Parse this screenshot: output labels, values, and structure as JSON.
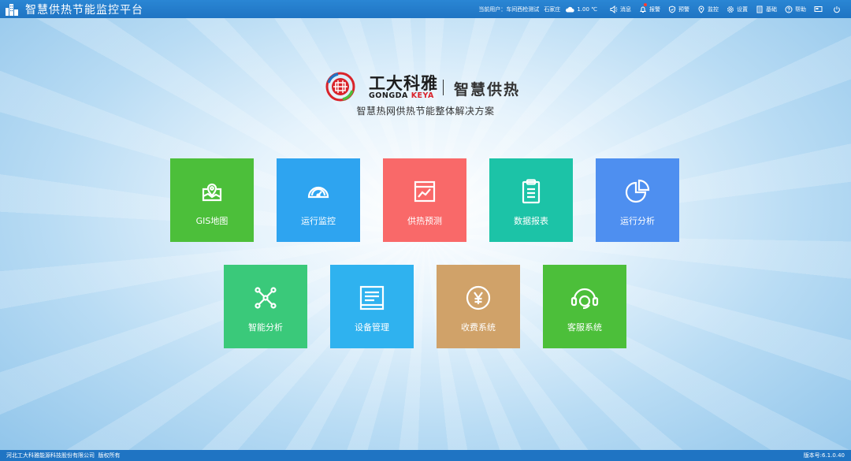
{
  "app": {
    "title": "智慧供热节能监控平台"
  },
  "topbar": {
    "user_prefix": "当前用户：",
    "user_name": "车间西检测试",
    "city": "石家庄",
    "temperature": "1.00 ℃",
    "items": [
      {
        "label": "消息",
        "icon": "speaker-icon"
      },
      {
        "label": "报警",
        "icon": "bell-icon"
      },
      {
        "label": "预警",
        "icon": "shield-icon"
      },
      {
        "label": "监控",
        "icon": "location-icon"
      },
      {
        "label": "设置",
        "icon": "gear-icon"
      },
      {
        "label": "基础",
        "icon": "document-icon"
      },
      {
        "label": "帮助",
        "icon": "help-icon"
      }
    ]
  },
  "brand": {
    "cn": "工大科雅",
    "en_a": "GONGDA",
    "en_b": "KEYA",
    "product": "智慧供热",
    "tagline": "智慧热网供热节能整体解决方案"
  },
  "tiles": [
    {
      "label": "GIS地图",
      "icon": "map-pin-icon",
      "color": "#4cbf3a"
    },
    {
      "label": "运行监控",
      "icon": "gauge-icon",
      "color": "#2ea4f0"
    },
    {
      "label": "供热预测",
      "icon": "trend-chart-icon",
      "color": "#f96969"
    },
    {
      "label": "数据报表",
      "icon": "clipboard-icon",
      "color": "#1cc3a7"
    },
    {
      "label": "运行分析",
      "icon": "pie-chart-icon",
      "color": "#4e8ff0"
    },
    {
      "label": "智能分析",
      "icon": "network-icon",
      "color": "#3ac97a"
    },
    {
      "label": "设备管理",
      "icon": "list-panel-icon",
      "color": "#2fb2ef"
    },
    {
      "label": "收费系统",
      "icon": "yen-coin-icon",
      "color": "#d0a269"
    },
    {
      "label": "客服系统",
      "icon": "headset-icon",
      "color": "#4cbf3a"
    }
  ],
  "footer": {
    "company": "河北工大科雅能源科技股份有限公司",
    "rights": "版权所有",
    "version": "版本号:6.1.0.40"
  }
}
